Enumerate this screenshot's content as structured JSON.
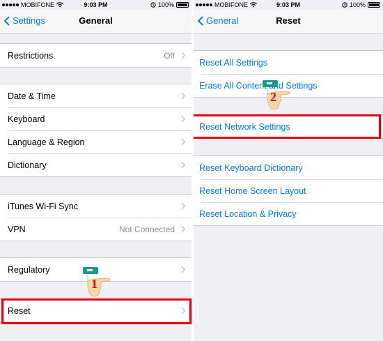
{
  "left": {
    "status": {
      "carrier": "MOBIFONE",
      "time": "9:03 PM",
      "battery": "100%"
    },
    "nav": {
      "back_label": "Settings",
      "title": "General"
    },
    "groups": [
      {
        "rows": [
          {
            "label": "Restrictions",
            "value": "Off"
          }
        ]
      },
      {
        "rows": [
          {
            "label": "Date & Time"
          },
          {
            "label": "Keyboard"
          },
          {
            "label": "Language & Region"
          },
          {
            "label": "Dictionary"
          }
        ]
      },
      {
        "rows": [
          {
            "label": "iTunes Wi-Fi Sync"
          },
          {
            "label": "VPN",
            "value": "Not Connected"
          }
        ]
      },
      {
        "rows": [
          {
            "label": "Regulatory"
          }
        ]
      },
      {
        "rows": [
          {
            "label": "Reset"
          }
        ]
      }
    ],
    "step_marker": "1"
  },
  "right": {
    "status": {
      "carrier": "MOBIFONE",
      "time": "9:03 PM",
      "battery": "100%"
    },
    "nav": {
      "back_label": "General",
      "title": "Reset"
    },
    "groups": [
      {
        "rows": [
          {
            "label": "Reset All Settings"
          },
          {
            "label": "Erase All Content and Settings"
          }
        ]
      },
      {
        "rows": [
          {
            "label": "Reset Network Settings"
          }
        ]
      },
      {
        "rows": [
          {
            "label": "Reset Keyboard Dictionary"
          },
          {
            "label": "Reset Home Screen Layout"
          },
          {
            "label": "Reset Location & Privacy"
          }
        ]
      }
    ],
    "step_marker": "2"
  },
  "colors": {
    "accent": "#007aff",
    "highlight": "#e3000f",
    "background": "#efeff4"
  },
  "icons": [
    "signal-icon",
    "wifi-icon",
    "alarm-icon",
    "battery-icon",
    "chevron-left-icon",
    "chevron-right-icon",
    "pointing-hand-icon"
  ]
}
